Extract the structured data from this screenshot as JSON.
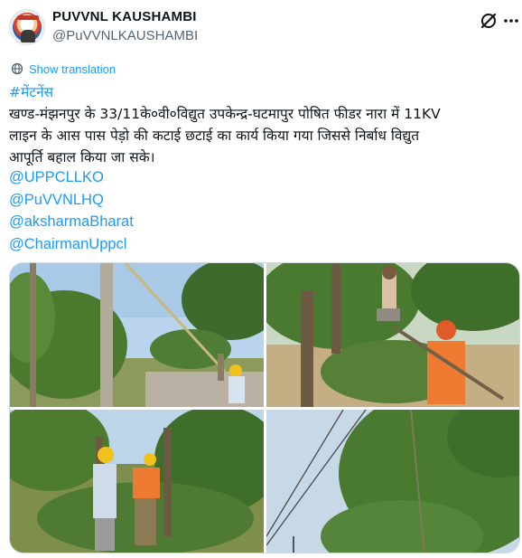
{
  "account": {
    "display_name": "PUVVNL KAUSHAMBI",
    "handle": "@PuVVNLKAUSHAMBI"
  },
  "header_icons": {
    "grok": "grok-icon",
    "more": "more-icon"
  },
  "translation": {
    "label": "Show translation",
    "icon": "globe-icon"
  },
  "post": {
    "hashtag": "#मेंटनेंस",
    "lines": [
      "खण्ड-मंझनपुर के 33/11के०वी०विद्युत उपकेन्द्र-घटमापुर पोषित फीडर नारा में 11KV",
      "लाइन के आस पास पेड़ो की कटाई छटाई का कार्य किया गया जिससे निर्बाध विद्युत",
      "आपूर्ति बहाल किया जा सके।"
    ],
    "mentions": [
      "@UPPCLLKO",
      "@PuVVNLHQ",
      "@aksharmaBharat",
      "@ChairmanUppcl"
    ]
  },
  "colors": {
    "link": "#1d9bf0",
    "text": "#0f1419",
    "secondary": "#536471",
    "border": "#cfd9de"
  }
}
